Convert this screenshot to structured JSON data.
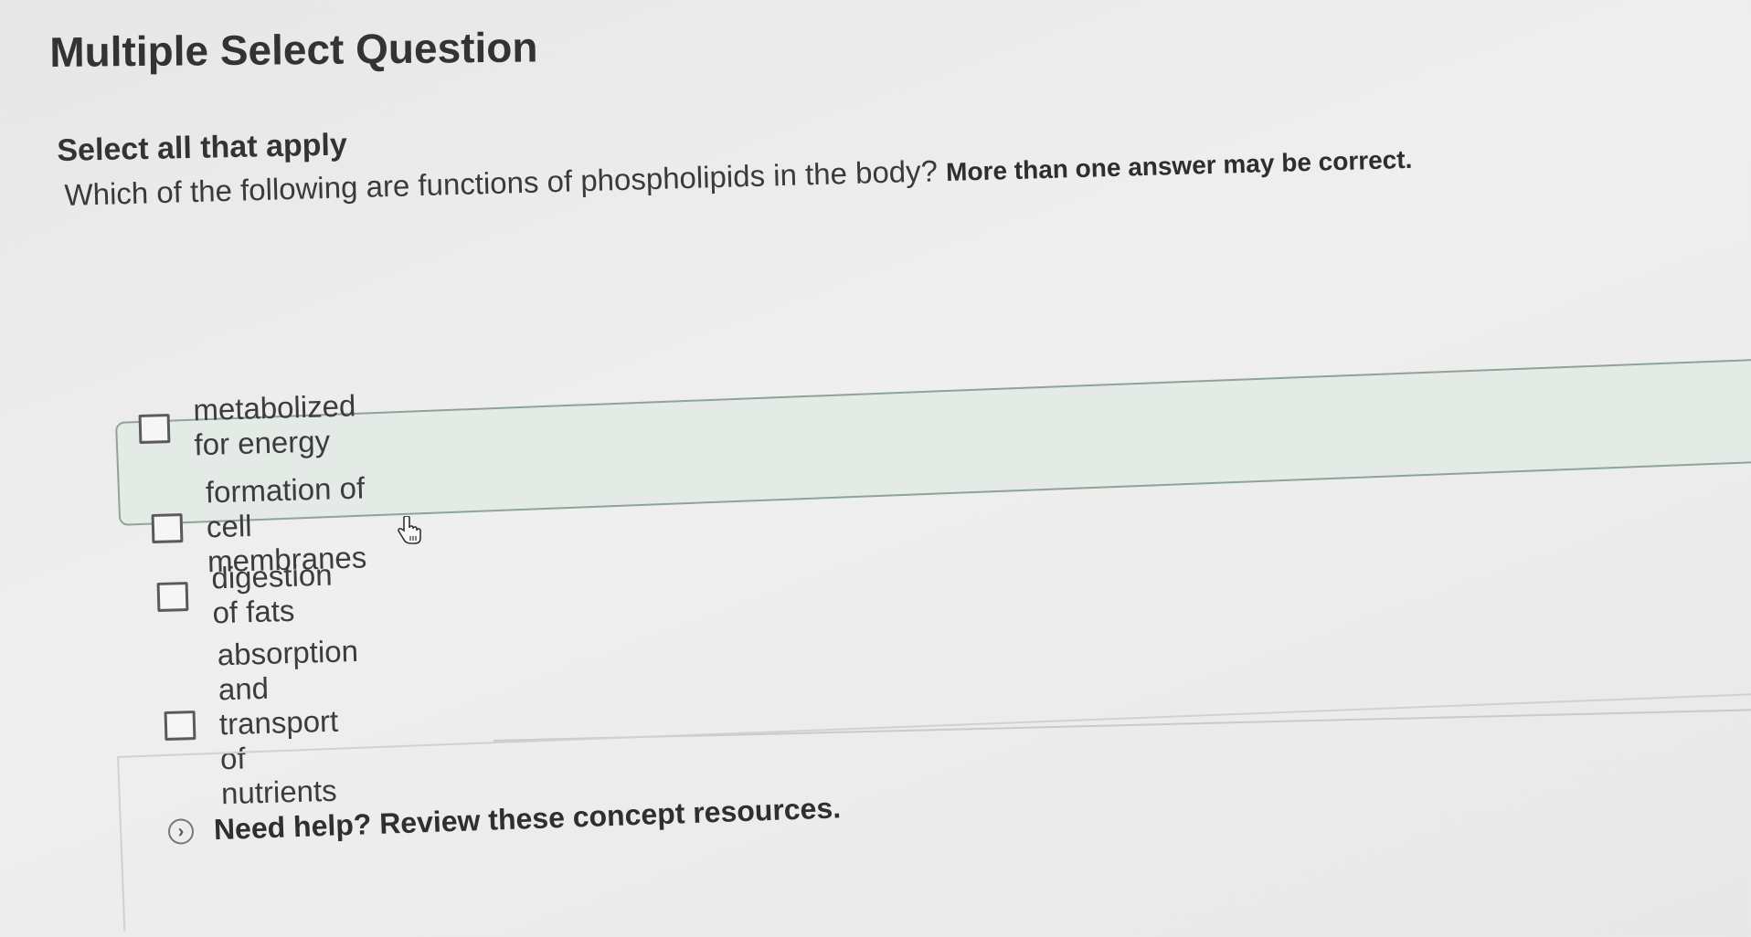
{
  "question": {
    "type_label": "Multiple Select Question",
    "instruction": "Select all that apply",
    "prompt": "Which of the following are functions of phospholipids in the body?",
    "prompt_emphasis": "More than one answer may be correct."
  },
  "options": [
    {
      "label": "metabolized for energy",
      "checked": false
    },
    {
      "label": "formation of cell membranes",
      "checked": false
    },
    {
      "label": "digestion of fats",
      "checked": false
    },
    {
      "label": "absorption and transport of nutrients",
      "checked": false
    }
  ],
  "help": {
    "label": "Need help? Review these concept resources.",
    "icon": "chevron-right-icon"
  },
  "colors": {
    "hover_row_bg": "#e4ebe6",
    "hover_row_border": "#8fa398"
  }
}
